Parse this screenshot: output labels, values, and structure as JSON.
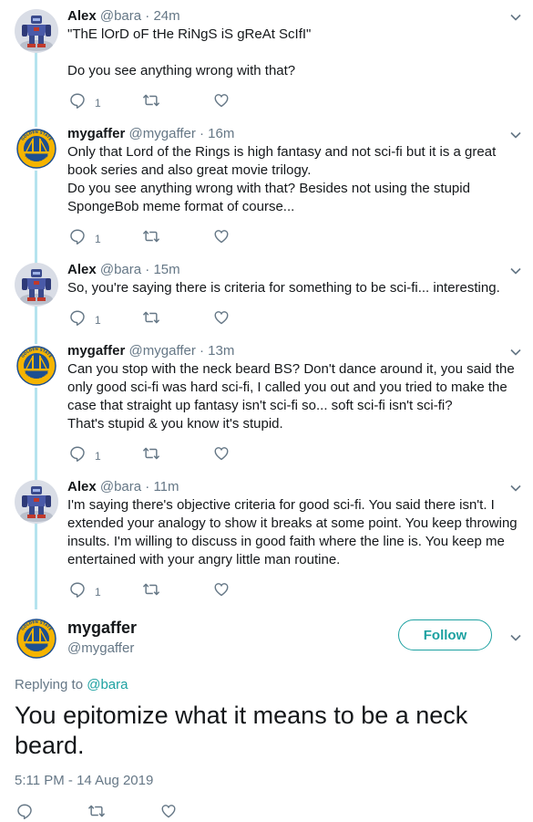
{
  "thread": [
    {
      "name": "Alex",
      "handle": "@bara",
      "time": "· 24m",
      "text": "\"ThE lOrD oF tHe RiNgS iS gReAt ScIfI\"\n\nDo you see anything wrong with that?",
      "reply_count": "1",
      "avatar": "robot-avatar"
    },
    {
      "name": "mygaffer",
      "handle": "@mygaffer",
      "time": "· 16m",
      "text": "Only that Lord of the Rings is high fantasy and not sci-fi but it is a great book series and also great movie trilogy.\nDo you see anything wrong with that? Besides not using the stupid SpongeBob meme format of course...",
      "reply_count": "1",
      "avatar": "warriors-logo-avatar"
    },
    {
      "name": "Alex",
      "handle": "@bara",
      "time": "· 15m",
      "text": "So, you're saying there is criteria for something to be sci-fi... interesting.",
      "reply_count": "1",
      "avatar": "robot-avatar"
    },
    {
      "name": "mygaffer",
      "handle": "@mygaffer",
      "time": "· 13m",
      "text": "Can you stop with the neck beard BS? Don't dance around it, you said the only good sci-fi was hard sci-fi, I called you out and you tried to make the case that straight up fantasy isn't sci-fi so... soft sci-fi isn't sci-fi?\nThat's stupid & you know it's stupid.",
      "reply_count": "1",
      "avatar": "warriors-logo-avatar"
    },
    {
      "name": "Alex",
      "handle": "@bara",
      "time": "· 11m",
      "text": "I'm saying there's objective criteria for good sci-fi. You said there isn't. I extended your analogy to show it breaks at some point. You keep throwing insults. I'm willing to discuss in good faith where the line is. You keep me entertained with your angry little man routine.",
      "reply_count": "1",
      "avatar": "robot-avatar"
    }
  ],
  "main": {
    "name": "mygaffer",
    "handle": "@mygaffer",
    "follow_label": "Follow",
    "replying_prefix": "Replying to",
    "replying_to": "@bara",
    "text": "You epitomize what it means to be a neck beard.",
    "timestamp": "5:11 PM - 14 Aug 2019"
  },
  "logo_text": {
    "top": "GOLDEN STATE",
    "bottom": "WARRIORS"
  },
  "colors": {
    "accent": "#1da1a1",
    "thread_line": "#b5e3ee",
    "secondary_text": "#657786",
    "warriors_blue": "#1d4f91",
    "warriors_gold": "#f5b400"
  }
}
